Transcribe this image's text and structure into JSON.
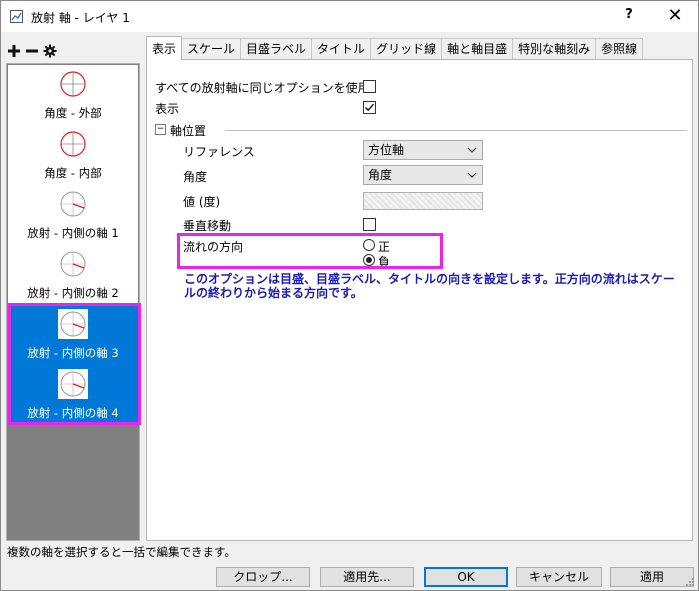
{
  "window": {
    "title": "放射 軸 - レイヤ 1",
    "help_label": "?",
    "close_label": "✕"
  },
  "left_toolbar": {
    "add_icon": "plus-icon",
    "remove_icon": "minus-icon",
    "settings_icon": "gear-icon"
  },
  "axes": [
    {
      "label": "角度 - 外部",
      "selected": false,
      "thumb": "angular-outer"
    },
    {
      "label": "角度 - 内部",
      "selected": false,
      "thumb": "angular-inner"
    },
    {
      "label": "放射 - 内側の軸 1",
      "selected": false,
      "thumb": "radial"
    },
    {
      "label": "放射 - 内側の軸 2",
      "selected": false,
      "thumb": "radial"
    },
    {
      "label": "放射 - 内側の軸 3",
      "selected": true,
      "thumb": "radial"
    },
    {
      "label": "放射 - 内側の軸 4",
      "selected": true,
      "thumb": "radial"
    }
  ],
  "tabs": [
    {
      "label": "表示",
      "active": true
    },
    {
      "label": "スケール",
      "active": false
    },
    {
      "label": "目盛ラベル",
      "active": false
    },
    {
      "label": "タイトル",
      "active": false
    },
    {
      "label": "グリッド線",
      "active": false
    },
    {
      "label": "軸と軸目盛",
      "active": false
    },
    {
      "label": "特別な軸刻み",
      "active": false
    },
    {
      "label": "参照線",
      "active": false
    }
  ],
  "display": {
    "same_options_label": "すべての放射軸に同じオプションを使用",
    "same_options_checked": false,
    "show_label": "表示",
    "show_checked": true,
    "section_label": "軸位置",
    "section_collapse": "−",
    "reference_label": "リファレンス",
    "reference_value": "方位軸",
    "angle_label": "角度",
    "angle_value": "角度",
    "value_label": "値 (度)",
    "value_input": "",
    "vertical_move_label": "垂直移動",
    "vertical_move_checked": false,
    "flow_label": "流れの方向",
    "flow_positive": "正",
    "flow_negative": "負",
    "flow_selected": "負",
    "info": "このオプションは目盛、目盛ラベル、タイトルの向きを設定します。正方向の流れはスケールの終わりから始まる方向です。"
  },
  "status": "複数の軸を選択すると一括で編集できます。",
  "buttons": {
    "crop": "クロップ...",
    "apply_to": "適用先...",
    "ok": "OK",
    "cancel": "キャンセル",
    "apply": "適用"
  },
  "colors": {
    "selection": "#0078d7",
    "highlight": "#ee22ee",
    "info_text": "#1a1aaf"
  }
}
